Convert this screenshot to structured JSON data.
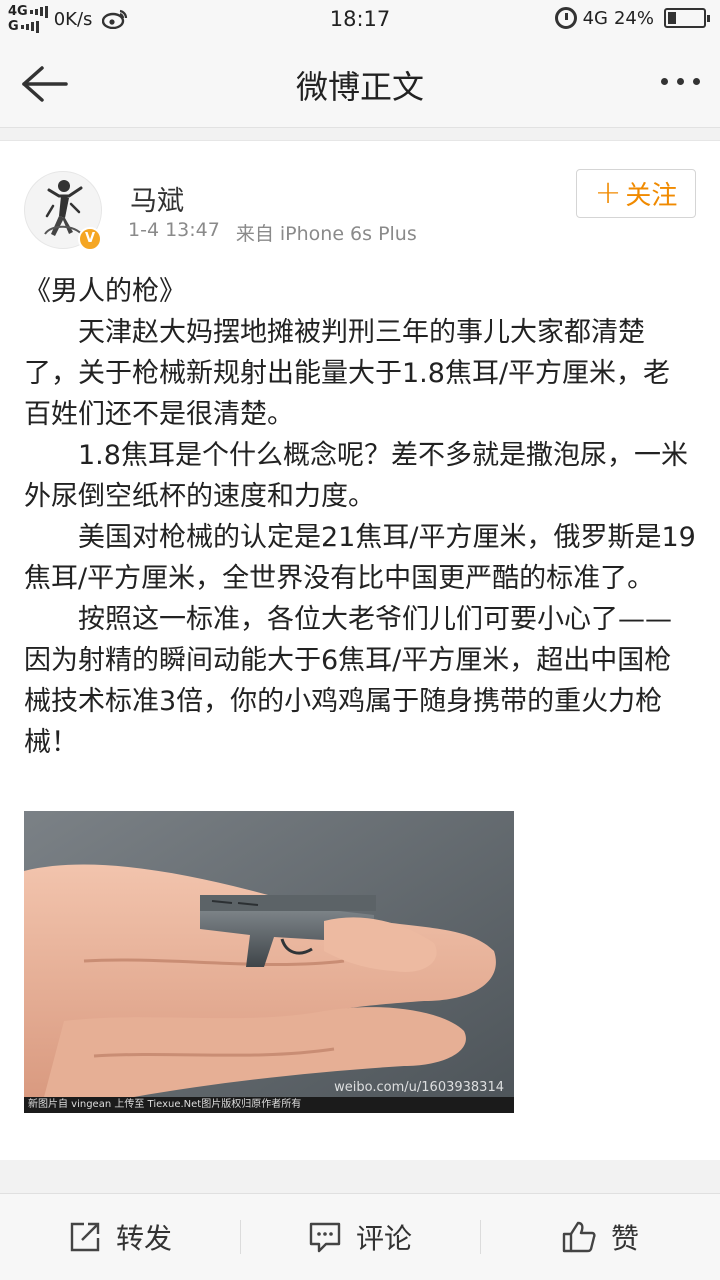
{
  "status_bar": {
    "network_top": "4G",
    "network_bottom": "G",
    "speed": "0K/s",
    "time": "18:17",
    "network_right": "4G",
    "battery": "24%",
    "battery_level": 0.24
  },
  "header": {
    "title": "微博正文"
  },
  "post": {
    "username": "马斌",
    "time": "1-4 13:47",
    "source": "来自 iPhone 6s Plus",
    "verified_badge": "V",
    "follow_label": "关注",
    "paragraphs": [
      "《男人的枪》",
      "天津赵大妈摆地摊被判刑三年的事儿大家都清楚了，关于枪械新规射出能量大于1.8焦耳/平方厘米，老百姓们还不是很清楚。",
      "1.8焦耳是个什么概念呢？差不多就是撒泡尿，一米外尿倒空纸杯的速度和力度。",
      "美国对枪械的认定是21焦耳/平方厘米，俄罗斯是19焦耳/平方厘米，全世界没有比中国更严酷的标准了。",
      "按照这一标准，各位大老爷们儿们可要小心了——因为射精的瞬间动能大于6焦耳/平方厘米，超出中国枪械技术标准3倍，你的小鸡鸡属于随身携带的重火力枪械！"
    ],
    "image_watermark": "weibo.com/u/1603938314",
    "image_caption": "新图片自 vingean 上传至 Tiexue.Net图片版权归原作者所有"
  },
  "actions": {
    "repost": "转发",
    "comment": "评论",
    "like": "赞"
  },
  "colors": {
    "accent": "#f08a00",
    "badge": "#f5a623"
  },
  "icons": [
    "back-arrow-icon",
    "more-icon",
    "plus-icon",
    "repost-icon",
    "comment-icon",
    "like-icon",
    "alarm-icon",
    "battery-icon",
    "weibo-icon"
  ]
}
